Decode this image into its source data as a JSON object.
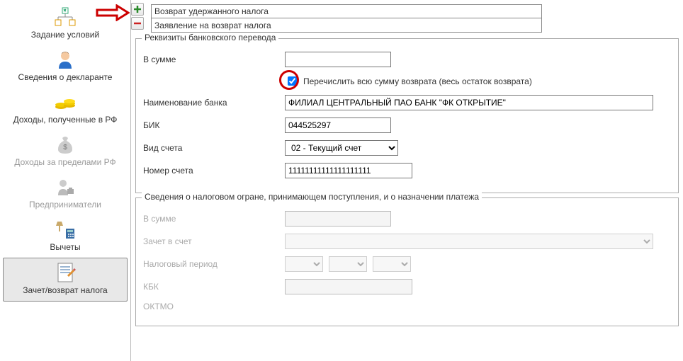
{
  "sidebar": {
    "items": [
      {
        "label": "Задание условий"
      },
      {
        "label": "Сведения о декларанте"
      },
      {
        "label": "Доходы, полученные в РФ"
      },
      {
        "label": "Доходы за пределами РФ"
      },
      {
        "label": "Предприниматели"
      },
      {
        "label": "Вычеты"
      },
      {
        "label": "Зачет/возврат налога"
      }
    ]
  },
  "topRows": {
    "row1": "Возврат удержанного налога",
    "row2": "Заявление на возврат налога"
  },
  "bank": {
    "legend": "Реквизиты банковского перевода",
    "sum_label": "В сумме",
    "sum_value": "",
    "chk_label": "Перечислить всю сумму возврата (весь остаток возврата)",
    "bankname_label": "Наименование банка",
    "bankname_value": "ФИЛИАЛ ЦЕНТРАЛЬНЫЙ ПАО БАНК \"ФК ОТКРЫТИЕ\"",
    "bik_label": "БИК",
    "bik_value": "044525297",
    "acct_type_label": "Вид счета",
    "acct_type_value": "02 - Текущий счет",
    "acct_num_label": "Номер счета",
    "acct_num_value": "11111111111111111111"
  },
  "tax": {
    "legend": "Сведения о налоговом огране, принимающем поступления, и о назначении платежа",
    "sum_label": "В сумме",
    "sum_value": "",
    "offset_label": "Зачет в счет",
    "offset_value": "",
    "period_label": "Налоговый период",
    "kbk_label": "КБК",
    "kbk_value": "",
    "oktmo_label": "ОКТМО"
  }
}
